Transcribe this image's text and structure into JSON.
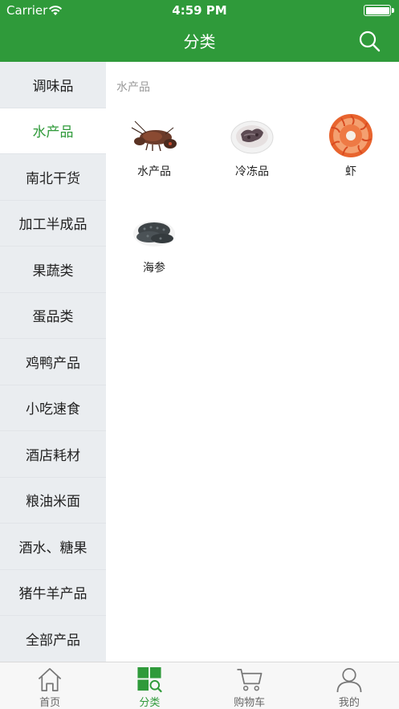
{
  "status_bar": {
    "carrier": "Carrier",
    "time": "4:59 PM"
  },
  "nav": {
    "title": "分类"
  },
  "sidebar": {
    "items": [
      {
        "label": "调味品"
      },
      {
        "label": "水产品"
      },
      {
        "label": "南北干货"
      },
      {
        "label": "加工半成品"
      },
      {
        "label": "果蔬类"
      },
      {
        "label": "蛋品类"
      },
      {
        "label": "鸡鸭产品"
      },
      {
        "label": "小吃速食"
      },
      {
        "label": "酒店耗材"
      },
      {
        "label": "粮油米面"
      },
      {
        "label": "酒水、糖果"
      },
      {
        "label": "猪牛羊产品"
      },
      {
        "label": "全部产品"
      }
    ],
    "active_index": 1
  },
  "content": {
    "section_title": "水产品",
    "categories": [
      {
        "label": "水产品",
        "icon": "lobster-image"
      },
      {
        "label": "冷冻品",
        "icon": "frozen-seafood-image"
      },
      {
        "label": "虾",
        "icon": "shrimp-platter-image"
      },
      {
        "label": "海参",
        "icon": "sea-cucumber-image"
      }
    ]
  },
  "tabbar": {
    "items": [
      {
        "label": "首页",
        "icon": "home-icon"
      },
      {
        "label": "分类",
        "icon": "category-icon"
      },
      {
        "label": "购物车",
        "icon": "cart-icon"
      },
      {
        "label": "我的",
        "icon": "profile-icon"
      }
    ],
    "active_index": 1
  },
  "colors": {
    "brand": "#2f9a3a",
    "sidebar_bg": "#eaedf0",
    "muted_text": "#999999"
  }
}
